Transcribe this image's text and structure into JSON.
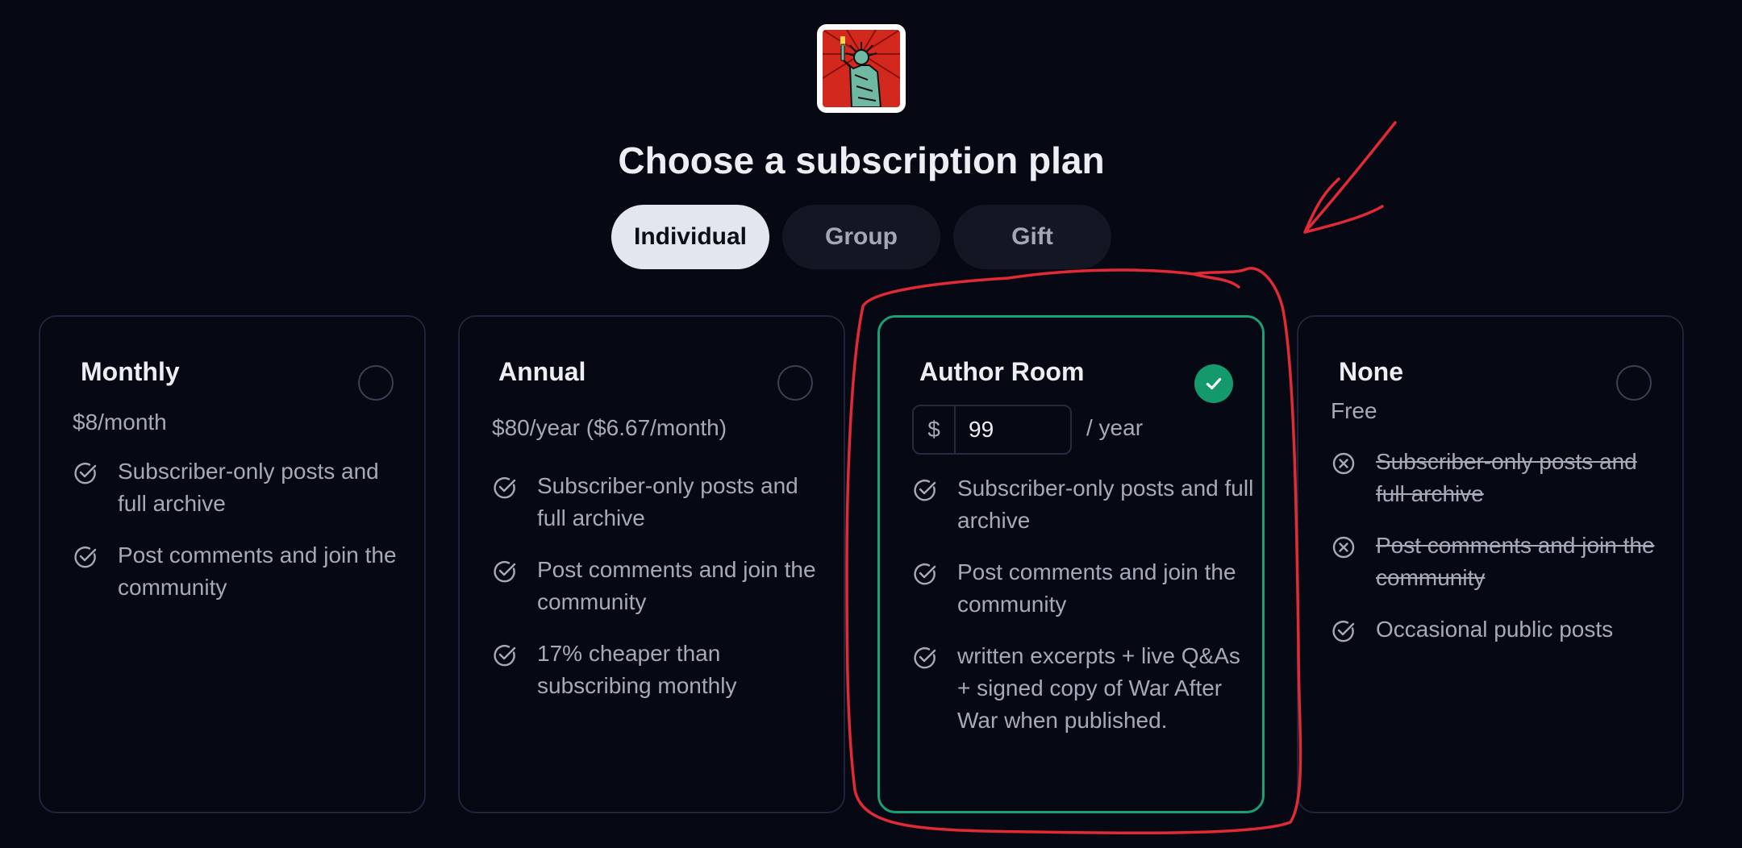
{
  "logo": {
    "icon": "statue-of-liberty-logo"
  },
  "title": "Choose a subscription plan",
  "tabs": [
    {
      "label": "Individual",
      "active": true
    },
    {
      "label": "Group",
      "active": false
    },
    {
      "label": "Gift",
      "active": false
    }
  ],
  "plans": [
    {
      "name": "Monthly",
      "price": "$8/month",
      "selected": false,
      "features": [
        {
          "text": "Subscriber-only posts and full archive",
          "included": true
        },
        {
          "text": "Post comments and join the community",
          "included": true
        }
      ]
    },
    {
      "name": "Annual",
      "price": "$80/year ($6.67/month)",
      "selected": false,
      "features": [
        {
          "text": "Subscriber-only posts and full archive",
          "included": true
        },
        {
          "text": "Post comments and join the community",
          "included": true
        },
        {
          "text": "17% cheaper than subscribing monthly",
          "included": true
        }
      ]
    },
    {
      "name": "Author Room",
      "currency": "$",
      "amount": "99",
      "period": "/ year",
      "selected": true,
      "features": [
        {
          "text": "Subscriber-only posts and full archive",
          "included": true
        },
        {
          "text": "Post comments and join the community",
          "included": true
        },
        {
          "text": "written excerpts + live Q&As + signed copy of War After War when published.",
          "included": true
        }
      ]
    },
    {
      "name": "None",
      "price": "Free",
      "selected": false,
      "features": [
        {
          "text": "Subscriber-only posts and full archive",
          "included": false
        },
        {
          "text": "Post comments and join the community",
          "included": false
        },
        {
          "text": "Occasional public posts",
          "included": true
        }
      ]
    }
  ],
  "colors": {
    "background": "#060814",
    "selected_border": "#1aa074",
    "annotation": "#e02a36"
  },
  "icons": {
    "included": "check-circle-icon",
    "excluded": "x-circle-icon",
    "selected": "checkmark-icon"
  }
}
